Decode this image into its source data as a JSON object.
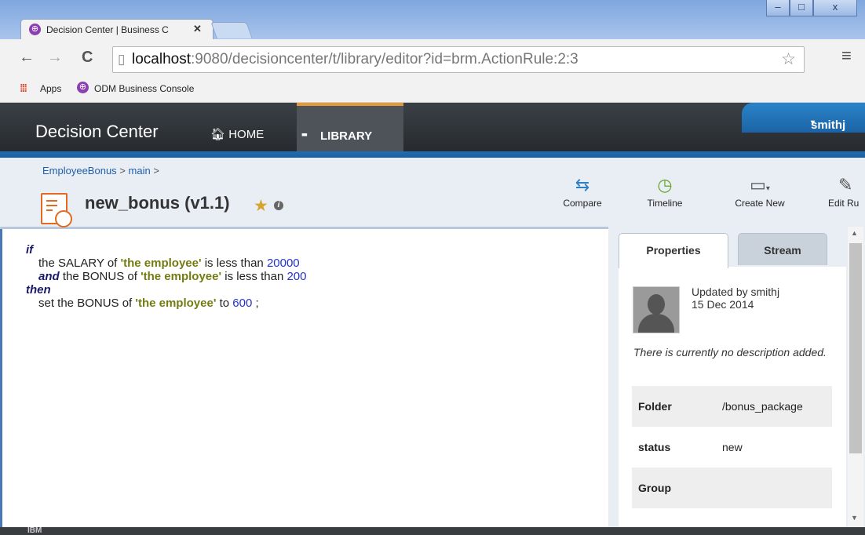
{
  "browser": {
    "tab_title": "Decision Center | Business C",
    "tab_close": "✕",
    "url_host": "localhost",
    "url_rest": ":9080/decisioncenter/t/library/editor?id=brm.ActionRule:2:3",
    "bookmarks": [
      "Apps",
      "ODM Business Console"
    ]
  },
  "header": {
    "brand": "Decision Center",
    "nav_home": "HOME",
    "nav_library": "LIBRARY",
    "user": "smithj"
  },
  "subheader": {
    "breadcrumb": [
      "EmployeeBonus",
      "main"
    ],
    "title": "new_bonus (v1.1)",
    "tools": [
      "Compare",
      "Timeline",
      "Create New",
      "Edit Ru"
    ]
  },
  "rule": {
    "if": "if",
    "l1_a": "the SALARY of",
    "l1_var": "'the employee'",
    "l1_b": "is less than",
    "l1_num": "20000",
    "l2_kw": "and",
    "l2_a": "the BONUS of",
    "l2_var": "'the employee'",
    "l2_b": "is less than",
    "l2_num": "200",
    "then": "then",
    "l3_a": "set the BONUS of",
    "l3_var": "'the employee'",
    "l3_b": "to",
    "l3_num": "600",
    "l3_end": ";"
  },
  "panel": {
    "tabs": [
      "Properties",
      "Stream"
    ],
    "updated_by": "Updated by smithj",
    "updated_date": "15 Dec 2014",
    "description": "There is currently no description added.",
    "properties": [
      {
        "key": "Folder",
        "value": "/bonus_package"
      },
      {
        "key": "status",
        "value": "new"
      },
      {
        "key": "Group",
        "value": ""
      }
    ]
  },
  "footer": {
    "text": "IBM"
  }
}
